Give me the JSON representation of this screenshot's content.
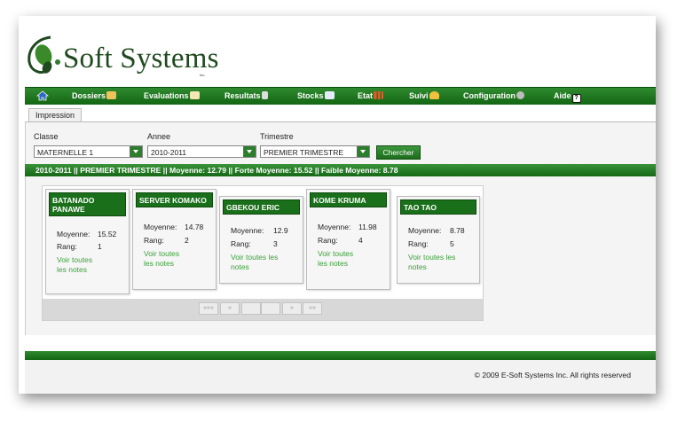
{
  "brand": {
    "name": "Soft Systems",
    "inc": "Inc."
  },
  "nav": [
    {
      "label": "Dossiers",
      "icon": "folder-icon",
      "color": "#f0c25a"
    },
    {
      "label": "Evaluations",
      "icon": "edit-document-icon",
      "color": "#f3e7b6"
    },
    {
      "label": "Resultats",
      "icon": "report-icon",
      "color": "#dddddd"
    },
    {
      "label": "Stocks",
      "icon": "mail-icon",
      "color": "#e6ecff"
    },
    {
      "label": "Etat",
      "icon": "bar-chart-icon",
      "color": "#e05a2a"
    },
    {
      "label": "Suivi",
      "icon": "user-icon",
      "color": "#f0c040"
    },
    {
      "label": "Configuration",
      "icon": "gear-icon",
      "color": "#bdbdbd"
    },
    {
      "label": "Aide",
      "icon": "help-icon",
      "color": "#ffffff"
    }
  ],
  "tab": {
    "label": "Impression"
  },
  "filters": {
    "classe": {
      "label": "Classe",
      "value": "MATERNELLE 1"
    },
    "annee": {
      "label": "Annee",
      "value": "2010-2011"
    },
    "trimestre": {
      "label": "Trimestre",
      "value": "PREMIER TRIMESTRE"
    },
    "search_label": "Chercher"
  },
  "summary": "2010-2011 || PREMIER TRIMESTRE || Moyenne: 12.79 || Forte Moyenne: 15.52 || Faible Moyenne: 8.78",
  "students": [
    {
      "name": "BATANADO PANAWE",
      "moyenne": "15.52",
      "rang": "1",
      "link": "Voir toutes les notes"
    },
    {
      "name": "SERVER KOMAKO",
      "moyenne": "14.78",
      "rang": "2",
      "link": "Voir toutes les notes"
    },
    {
      "name": "GBEKOU ERIC",
      "moyenne": "12.9",
      "rang": "3",
      "link": "Voir toutes les notes"
    },
    {
      "name": "KOME KRUMA",
      "moyenne": "11.98",
      "rang": "4",
      "link": "Voir toutes les notes"
    },
    {
      "name": "TAO TAO",
      "moyenne": "8.78",
      "rang": "5",
      "link": "Voir toutes les notes"
    }
  ],
  "labels": {
    "moyenne": "Moyenne:",
    "rang": "Rang:"
  },
  "pager": {
    "first": "«««",
    "prev": "«",
    "next": "»",
    "last": "»»"
  },
  "footer": {
    "copyright": "© 2009 E-Soft Systems Inc. All rights reserved"
  },
  "colors": {
    "brand_green": "#1a6f1a",
    "link_green": "#3aa13a"
  }
}
